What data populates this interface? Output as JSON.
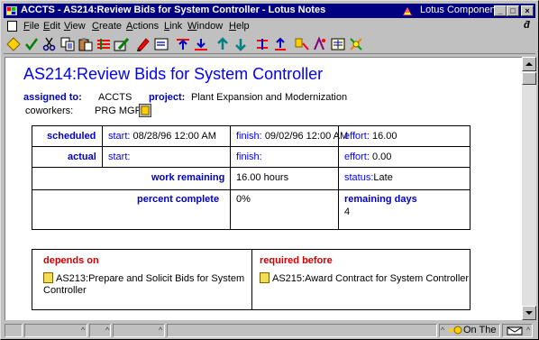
{
  "window": {
    "title": "ACCTS - AS214:Review Bids for System Controller - Lotus Notes",
    "lotus_components": "Lotus Components",
    "controls": {
      "minimize": "_",
      "maximize": "□",
      "close": "×"
    }
  },
  "menu": {
    "items": [
      "File",
      "Edit",
      "View",
      "Create",
      "Actions",
      "Link",
      "Window",
      "Help"
    ],
    "restore_glyph": "ƌ"
  },
  "toolbar": {
    "icons": [
      "navigator-icon",
      "check-icon",
      "cut-icon",
      "copy-icon",
      "paste-icon",
      "attach-icon",
      "pencil-icon",
      "form-icon",
      "text-align-icon",
      "sort-icon",
      "move-down-icon",
      "move-up-icon",
      "indent-icon",
      "outdent-icon",
      "user-icon",
      "link-icon",
      "chart-icon",
      "bookmark-icon"
    ]
  },
  "document": {
    "title": "AS214:Review Bids for System Controller",
    "assigned_label": "assigned to:",
    "assigned_value": "ACCTS",
    "project_label": "project:",
    "project_value": "Plant Expansion and Modernization",
    "coworkers_label": "coworkers:",
    "coworkers_value": "PRG MGR",
    "schedule": {
      "scheduled_label": "scheduled",
      "start_label": "start:",
      "start_value": "08/28/96 12:00 AM",
      "finish_label": "finish:",
      "finish_value": "09/02/96 12:00 AM",
      "effort_label": "effort:",
      "effort_value": "16.00",
      "actual_label": "actual",
      "actual_start_label": "start:",
      "actual_finish_label": "finish:",
      "actual_effort_label": "effort:",
      "actual_effort_value": "0.00",
      "work_remaining_label": "work remaining",
      "work_remaining_value": "16.00 hours",
      "status_label": "status:",
      "status_value": "Late",
      "percent_complete_label": "percent complete",
      "percent_complete_value": "0%",
      "remaining_days_label": "remaining days",
      "remaining_days_value": "4"
    },
    "depends_on_label": "depends on",
    "depends_on_item": "AS213:Prepare and Solicit Bids for System Controller",
    "required_before_label": "required before",
    "required_before_item": "AS215:Award Contract for System Controller"
  },
  "statusbar": {
    "location": "On The Glass\\",
    "carets": [
      "^",
      "^",
      "^",
      "^"
    ]
  }
}
